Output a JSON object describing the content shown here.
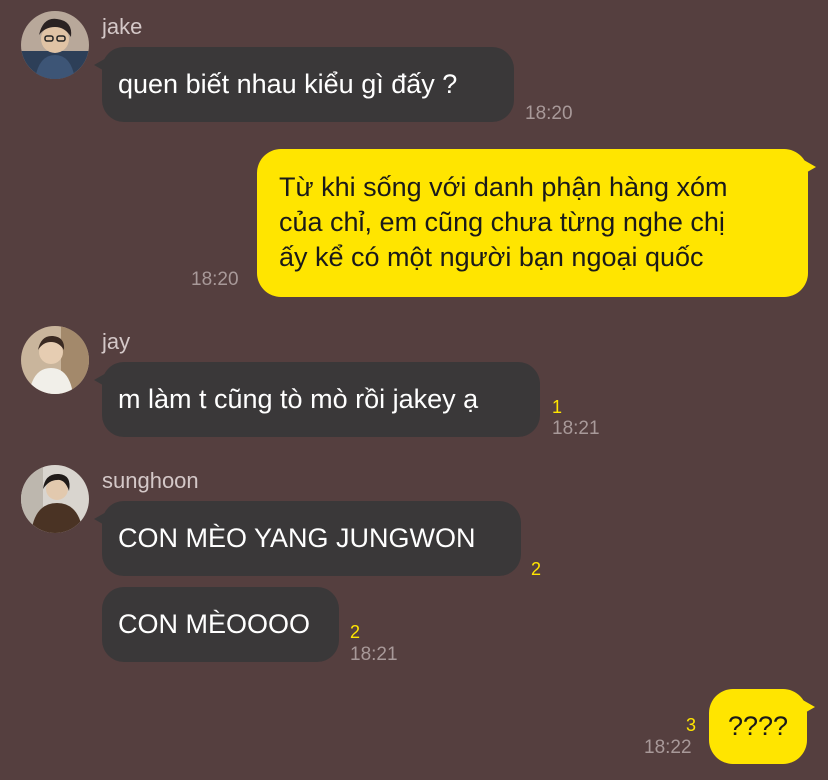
{
  "messages": {
    "jake": {
      "sender": "jake",
      "text": "quen biết nhau kiểu gì đấy ?",
      "time": "18:20"
    },
    "me1": {
      "lines": [
        "Từ khi sống với danh phận hàng xóm",
        "của chỉ, em cũng chưa từng nghe chị",
        "ấy kể có một người bạn ngoại quốc"
      ],
      "time": "18:20"
    },
    "jay": {
      "sender": "jay",
      "text": "m làm t cũng tò mò rồi jakey ạ",
      "unread": "1",
      "time": "18:21"
    },
    "sunghoon": {
      "sender": "sunghoon",
      "msg1": {
        "text": "CON MÈO YANG JUNGWON",
        "unread": "2"
      },
      "msg2": {
        "text": "CON MÈOOOO",
        "unread": "2",
        "time": "18:21"
      }
    },
    "me2": {
      "text": "????",
      "unread": "3",
      "time": "18:22"
    }
  },
  "colors": {
    "background": "#553f3f",
    "incoming_bubble": "#3a3839",
    "outgoing_bubble": "#ffe500",
    "unread_count": "#ffe500",
    "timestamp": "#a89999"
  },
  "icons": {
    "avatar_jake": "avatar",
    "avatar_jay": "avatar",
    "avatar_sunghoon": "avatar"
  }
}
